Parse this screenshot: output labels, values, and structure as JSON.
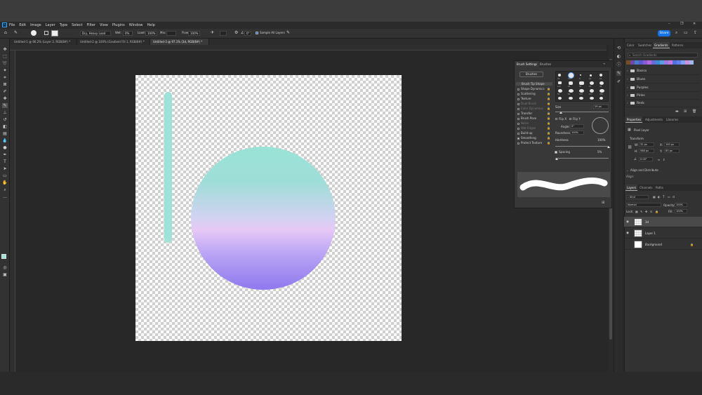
{
  "menu": {
    "items": [
      "File",
      "Edit",
      "Image",
      "Layer",
      "Type",
      "Select",
      "Filter",
      "View",
      "Plugins",
      "Window",
      "Help"
    ],
    "logo": "Ps"
  },
  "window_controls": {
    "minimize": "–",
    "restore": "❐",
    "close": "✕"
  },
  "options": {
    "mode_select": "Dry, Heavy Load",
    "wet_label": "Wet:",
    "wet_value": "0%",
    "load_label": "Load:",
    "load_value": "100%",
    "mix_label": "Mix:",
    "flow_label": "Flow:",
    "flow_value": "100%",
    "angle_value": "0°",
    "sample_all": "Sample All Layers",
    "share": "Share"
  },
  "tabs": [
    "Untitled-1 @ 66.2% (Layer 2, RGB/8#) *",
    "Untitled-2 @ 100% (Gradient Fill 1, RGB/8#) *",
    "Untitled-3 @ 97.1% (3d, RGB/8#) *"
  ],
  "brush_panel": {
    "tabs": [
      "Brush Settings",
      "Brushes"
    ],
    "brushes_button": "Brushes",
    "options": [
      {
        "label": "Brush Tip Shape",
        "state": "active"
      },
      {
        "label": "Shape Dynamics",
        "state": "normal"
      },
      {
        "label": "Scattering",
        "state": "normal"
      },
      {
        "label": "Texture",
        "state": "normal"
      },
      {
        "label": "Dual Brush",
        "state": "dim"
      },
      {
        "label": "Color Dynamics",
        "state": "dim"
      },
      {
        "label": "Transfer",
        "state": "normal"
      },
      {
        "label": "Brush Pose",
        "state": "normal"
      },
      {
        "label": "Noise",
        "state": "dim"
      },
      {
        "label": "Wet Edges",
        "state": "dim"
      },
      {
        "label": "Build-up",
        "state": "normal"
      },
      {
        "label": "Smoothing",
        "state": "normal"
      },
      {
        "label": "Protect Texture",
        "state": "normal"
      }
    ],
    "tip_sizes": [
      "30",
      "123",
      "8",
      "10",
      "25",
      "112",
      "60",
      "50",
      "25",
      "30",
      "50",
      "60",
      "100",
      "127",
      "284",
      "80",
      "174",
      "175",
      "306",
      "50"
    ],
    "size_label": "Size",
    "size_value": "29 px",
    "flip_x": "Flip X",
    "flip_y": "Flip Y",
    "angle_label": "Angle:",
    "angle_value": "0°",
    "roundness_label": "Roundness:",
    "roundness_value": "100%",
    "hardness_label": "Hardness",
    "hardness_value": "100%",
    "spacing_label": "Spacing",
    "spacing_value": "5%"
  },
  "right_panel": {
    "top_tabs": [
      "Color",
      "Swatches",
      "Gradients",
      "Patterns"
    ],
    "search_placeholder": "Search Gradients",
    "swatch_colors": [
      "#7b4a2a",
      "#6b4aa8",
      "#4a7ac8",
      "#5a5ad0",
      "#8a5ad8",
      "#b06ad8",
      "#6a6ad8",
      "#3a8ad8",
      "#5aa0e0",
      "#9a7ae0",
      "#c07ae0",
      "#5070e0",
      "#6080f0",
      "#80a0f0",
      "#d090e0",
      "#a0b8f0"
    ],
    "folders": [
      "Basics",
      "Blues",
      "Purples",
      "Pinks",
      "Reds"
    ],
    "props_tabs": [
      "Properties",
      "Adjustments",
      "Libraries"
    ],
    "pixel_layer": "Pixel Layer",
    "transform_label": "Transform",
    "w_label": "W:",
    "w_value": "32 px",
    "x_label": "X:",
    "x_value": "100 px",
    "h_label": "H:",
    "h_value": "568 px",
    "y_label": "Y:",
    "y_value": "63 px",
    "rot_value": "0.00°",
    "align_label": "Align and Distribute",
    "align_sub": "Align:",
    "layers_tabs": [
      "Layers",
      "Channels",
      "Paths"
    ],
    "kind": "Kind",
    "blend": "Normal",
    "opacity_label": "Opacity:",
    "opacity_value": "100%",
    "lock_label": "Lock:",
    "fill_label": "Fill:",
    "fill_value": "100%",
    "layers": [
      {
        "name": "3d",
        "selected": true
      },
      {
        "name": "Layer 1",
        "selected": false
      },
      {
        "name": "Background",
        "selected": false
      }
    ]
  }
}
